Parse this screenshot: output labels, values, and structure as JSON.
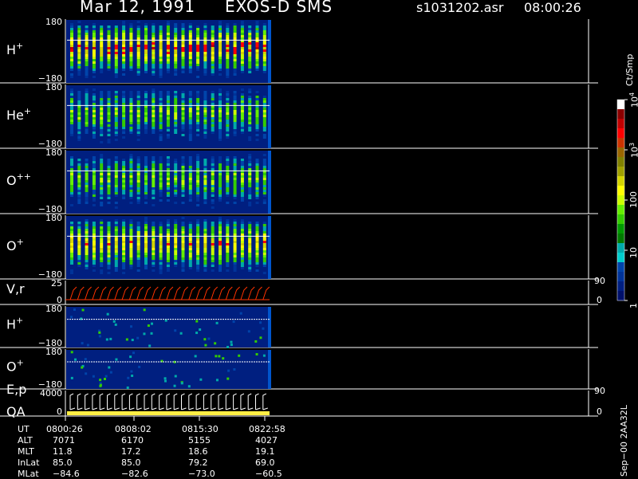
{
  "header": {
    "date": "Mar 12, 1991",
    "instrument": "EXOS-D SMS",
    "file": "s1031202.asr",
    "time": "08:00:26"
  },
  "chart_data": {
    "type": "heatmap",
    "panels": [
      {
        "id": "hplus",
        "label": "H",
        "sup": "+",
        "ytop": "180",
        "ybot": "−180",
        "kind": "spectrogram",
        "intensity": 0.95
      },
      {
        "id": "heplus",
        "label": "He",
        "sup": "+",
        "ytop": "180",
        "ybot": "−180",
        "kind": "spectrogram",
        "intensity": 0.6
      },
      {
        "id": "oplusplus",
        "label": "O",
        "sup": "++",
        "ytop": "180",
        "ybot": "−180",
        "kind": "spectrogram",
        "intensity": 0.6
      },
      {
        "id": "oplus",
        "label": "O",
        "sup": "+",
        "ytop": "180",
        "ybot": "−180",
        "kind": "spectrogram",
        "intensity": 0.85
      },
      {
        "id": "vr",
        "label": "V,r",
        "sup": "",
        "ytop": "25",
        "ybot": "0",
        "rtop": "90",
        "rbot": "0",
        "kind": "lines"
      },
      {
        "id": "hplus2",
        "label": "H",
        "sup": "+",
        "ytop": "180",
        "ybot": "−180",
        "kind": "sparse"
      },
      {
        "id": "oplus2",
        "label": "O",
        "sup": "+",
        "ytop": "180",
        "ybot": "−180",
        "kind": "sparse"
      },
      {
        "id": "ep",
        "label": "E,p",
        "sup": "",
        "label2": "QA",
        "ytop": "4000",
        "ybot": "0",
        "rtop": "90",
        "rbot": "0",
        "kind": "hooks"
      }
    ],
    "colorbar": {
      "unit": "Ct/Smp",
      "ticks": [
        {
          "base": "10",
          "exp": "4",
          "value": 10000
        },
        {
          "base": "10",
          "exp": "3",
          "value": 1000
        },
        {
          "base": "100",
          "exp": "",
          "value": 100
        },
        {
          "base": "10",
          "exp": "",
          "value": 10
        },
        {
          "base": "1",
          "exp": "",
          "value": 1
        }
      ],
      "colors": [
        "#ffffff",
        "#8b0000",
        "#c00000",
        "#ff0000",
        "#cc3300",
        "#996600",
        "#808000",
        "#a0a000",
        "#d4d400",
        "#ffff00",
        "#ccff00",
        "#66ee00",
        "#33cc00",
        "#009900",
        "#007a00",
        "#00aaaa",
        "#00cccc",
        "#0044aa",
        "#003399",
        "#001f80",
        "#00106a"
      ]
    },
    "time_axis": [
      "0800:26",
      "0808:02",
      "0815:30",
      "0822:58"
    ],
    "orbit": [
      {
        "name": "UT",
        "values": [
          "0800:26",
          "0808:02",
          "0815:30",
          "0822:58"
        ]
      },
      {
        "name": "ALT",
        "values": [
          "7071",
          "6170",
          "5155",
          "4027"
        ]
      },
      {
        "name": "MLT",
        "values": [
          "11.8",
          "17.2",
          "18.6",
          "19.1"
        ]
      },
      {
        "name": "InLat",
        "values": [
          "85.0",
          "85.0",
          "79.2",
          "69.0"
        ]
      },
      {
        "name": "MLat",
        "values": [
          "−84.6",
          "−82.6",
          "−73.0",
          "−60.5"
        ]
      }
    ]
  },
  "side_tag": "Sep−00 2AA32L"
}
